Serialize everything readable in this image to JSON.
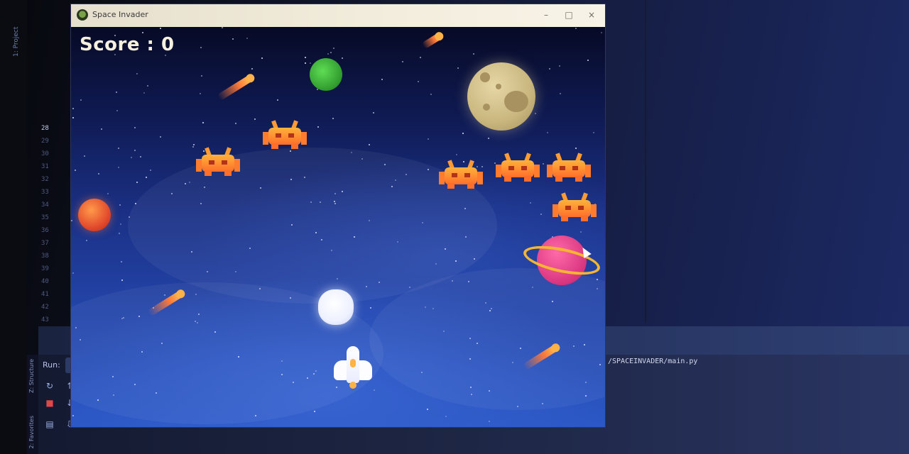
{
  "game": {
    "window_title": "Space Invader",
    "score_text": "Score : 0",
    "title_buttons": {
      "minimize": "–",
      "maximize": "□",
      "close": "×"
    }
  },
  "ide": {
    "sidebar_tab": "1: Project",
    "line_numbers": [
      "28",
      "29",
      "30",
      "31",
      "32",
      "33",
      "34",
      "35",
      "36",
      "37",
      "38",
      "39",
      "40",
      "41",
      "42",
      "43"
    ],
    "run_label": "Run:",
    "run_path": "/SPACEINVADER/main.py",
    "vertical_tabs": [
      "Z: Structure",
      "2: Favorites"
    ],
    "run_tools": [
      "rerun-icon",
      "stop-icon",
      "up-icon",
      "down-icon",
      "layout-icon",
      "pin-icon"
    ]
  },
  "colors": {
    "background_top": "#070a26",
    "background_bottom": "#2b58c6",
    "invader": "#ff7c2e",
    "score": "#f6f0de"
  }
}
